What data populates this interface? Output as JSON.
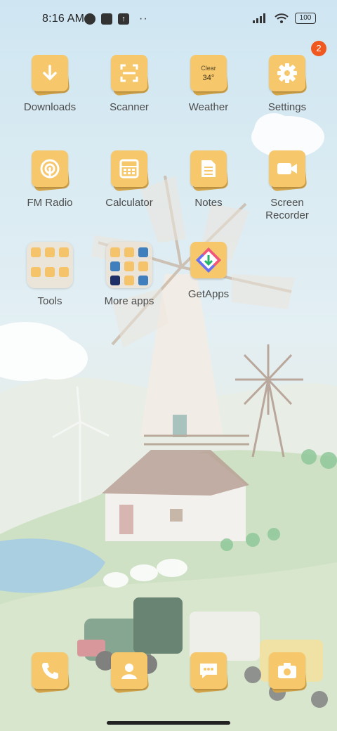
{
  "status_bar": {
    "time": "8:16 AM",
    "battery": "100"
  },
  "apps": {
    "downloads": "Downloads",
    "scanner": "Scanner",
    "weather": "Weather",
    "weather_condition": "Clear",
    "weather_temp": "34°",
    "settings": "Settings",
    "settings_badge": "2",
    "fm_radio": "FM Radio",
    "calculator": "Calculator",
    "notes": "Notes",
    "screen_recorder": "Screen Recorder",
    "tools": "Tools",
    "more_apps": "More apps",
    "getapps": "GetApps"
  },
  "icons": {
    "downloads": "download-arrow-icon",
    "scanner": "scan-frame-icon",
    "settings": "gear-icon",
    "fm_radio": "radio-wave-icon",
    "calculator": "calculator-icon",
    "notes": "notes-icon",
    "screen_recorder": "camera-icon",
    "dock_phone": "phone-icon",
    "dock_contacts": "contacts-icon",
    "dock_messages": "message-icon",
    "dock_camera": "camera-icon"
  },
  "colors": {
    "tile": "#f7c86b",
    "tile_shadow": "#d5a64b",
    "badge": "#f0581f"
  }
}
